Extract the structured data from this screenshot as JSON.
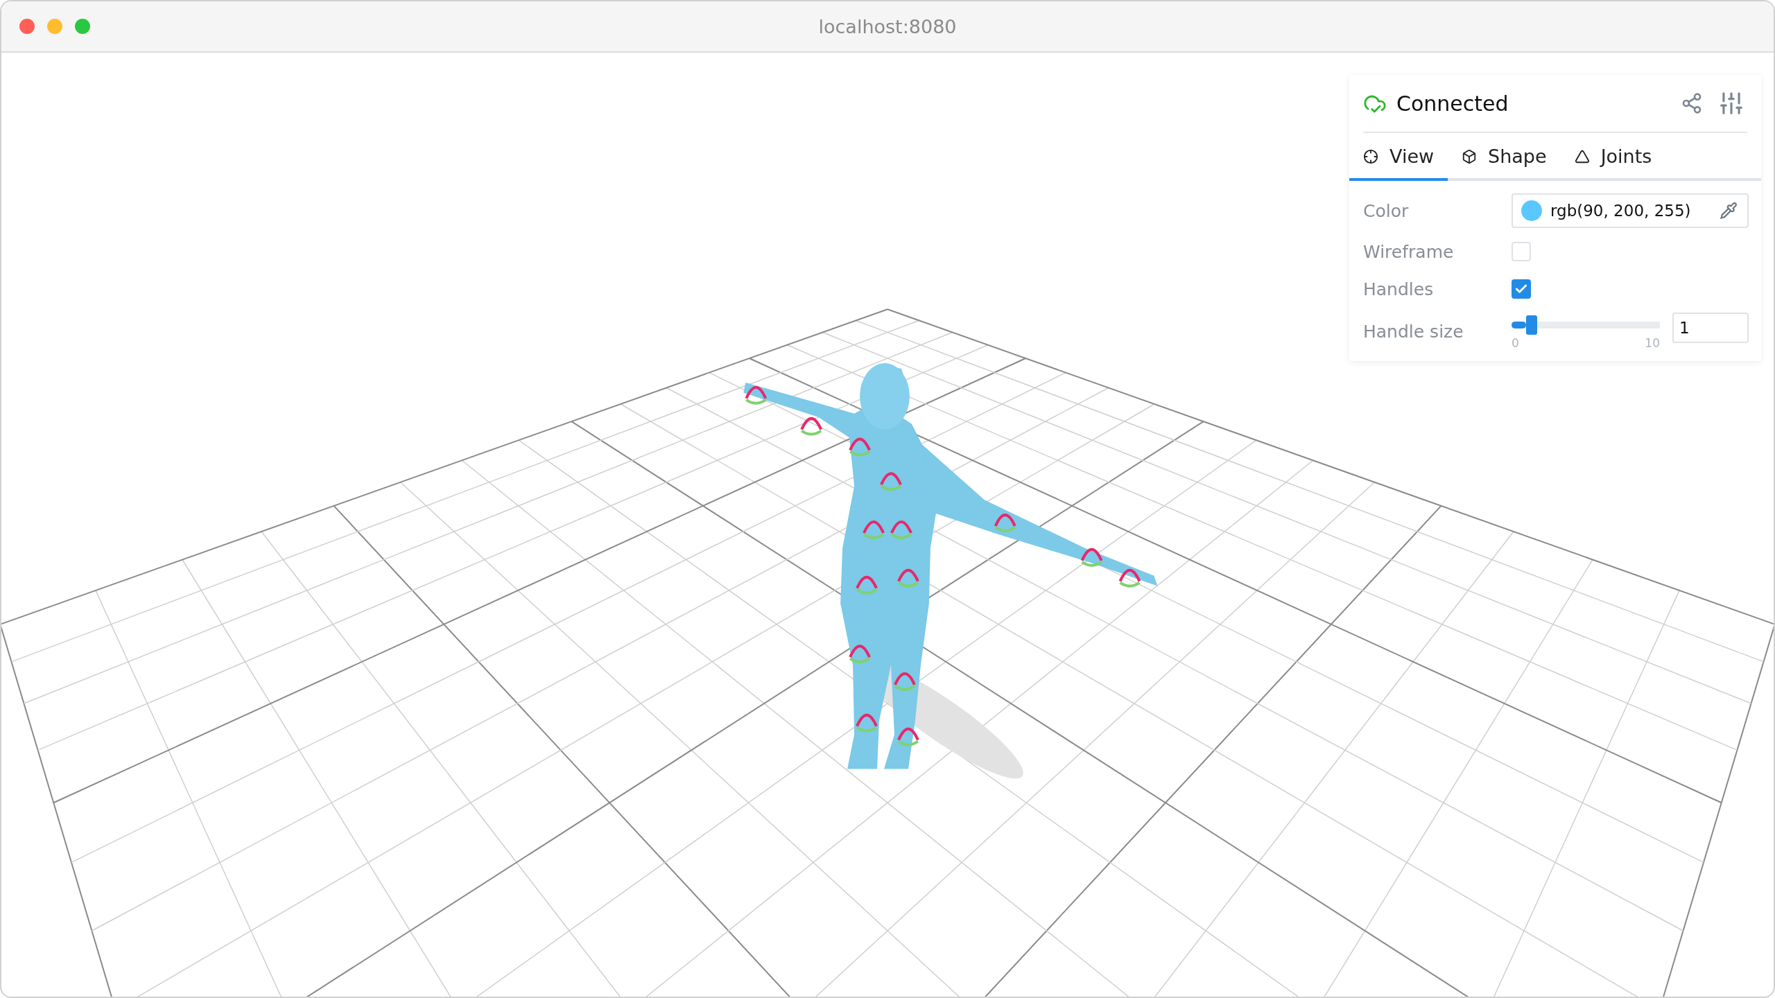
{
  "window": {
    "title": "localhost:8080"
  },
  "panel": {
    "status": "Connected",
    "tabs": [
      {
        "label": "View",
        "selected": true
      },
      {
        "label": "Shape",
        "selected": false
      },
      {
        "label": "Joints",
        "selected": false
      }
    ],
    "rows": [
      {
        "kind": "color",
        "label": "Color",
        "value": "rgb(90, 200, 255)",
        "color": "#5ac8ff"
      },
      {
        "kind": "checkbox",
        "label": "Wireframe",
        "checked": false
      },
      {
        "kind": "checkbox",
        "label": "Handles",
        "checked": true
      },
      {
        "kind": "slider",
        "label": "Handle size",
        "level": 0.1,
        "min": "0",
        "max": "10",
        "value": "1"
      }
    ]
  }
}
